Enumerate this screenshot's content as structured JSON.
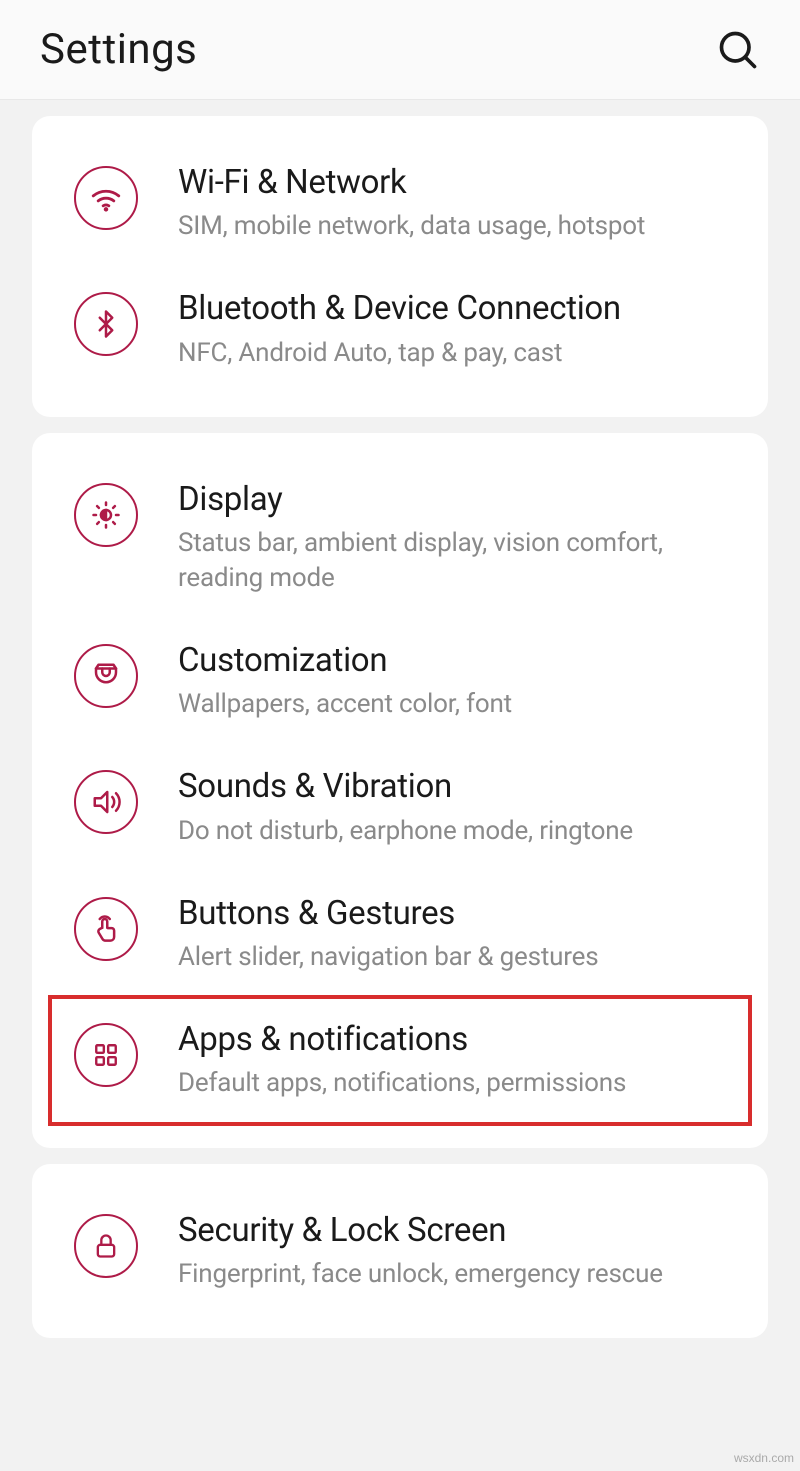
{
  "header": {
    "title": "Settings"
  },
  "accent": "#ae1b48",
  "groups": [
    {
      "rows": [
        {
          "icon": "wifi",
          "title": "Wi-Fi & Network",
          "sub": "SIM, mobile network, data usage, hotspot",
          "highlighted": false
        },
        {
          "icon": "bluetooth",
          "title": "Bluetooth & Device Connection",
          "sub": "NFC, Android Auto, tap & pay, cast",
          "highlighted": false
        }
      ]
    },
    {
      "rows": [
        {
          "icon": "display",
          "title": "Display",
          "sub": "Status bar, ambient display, vision comfort, reading mode",
          "highlighted": false
        },
        {
          "icon": "customization",
          "title": "Customization",
          "sub": "Wallpapers, accent color, font",
          "highlighted": false
        },
        {
          "icon": "sounds",
          "title": "Sounds & Vibration",
          "sub": "Do not disturb, earphone mode, ringtone",
          "highlighted": false
        },
        {
          "icon": "buttons",
          "title": "Buttons & Gestures",
          "sub": "Alert slider, navigation bar & gestures",
          "highlighted": false
        },
        {
          "icon": "apps",
          "title": "Apps & notifications",
          "sub": "Default apps, notifications, permissions",
          "highlighted": true
        }
      ]
    },
    {
      "rows": [
        {
          "icon": "security",
          "title": "Security & Lock Screen",
          "sub": "Fingerprint, face unlock, emergency rescue",
          "highlighted": false
        }
      ]
    }
  ],
  "watermark": "wsxdn.com"
}
